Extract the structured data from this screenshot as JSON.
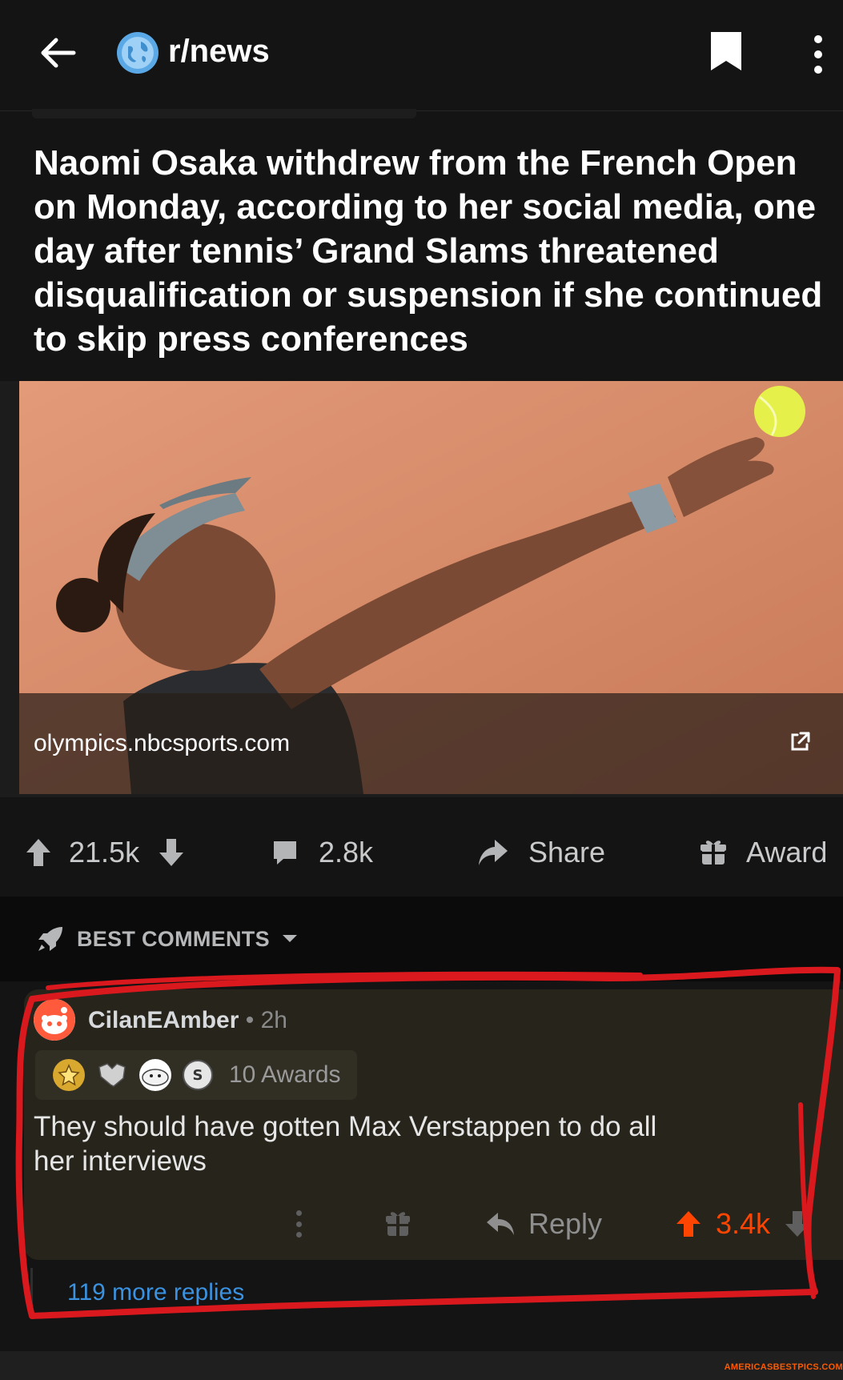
{
  "header": {
    "subreddit": "r/news",
    "icons": [
      "back-arrow-icon",
      "globe-icon",
      "bookmark-icon",
      "more-vertical-icon"
    ]
  },
  "post": {
    "title": "Naomi Osaka withdrew from the French Open on Monday, according to her social media, one day after tennis’ Grand Slams threatened disqualification or suspension if she continued to skip press conferences",
    "link_domain": "olympics.nbcsports.com",
    "votes": "21.5k",
    "comments": "2.8k",
    "share_label": "Share",
    "award_label": "Award"
  },
  "sort": {
    "label": "BEST COMMENTS"
  },
  "comment": {
    "username": "CilanEAmber",
    "separator": " • ",
    "age": "2h",
    "awards_label": "10 Awards",
    "body": "They should have gotten Max Verstappen to do all her interviews",
    "reply_label": "Reply",
    "votes": "3.4k",
    "more_replies": "119 more replies"
  },
  "watermark": "AMERICASBESTPICS.COM",
  "colors": {
    "background": "#141414",
    "upvote_active": "#ff4500",
    "link_blue": "#3a92e0",
    "annotation_red": "#d9191e",
    "comment_bg": "#27241b"
  }
}
